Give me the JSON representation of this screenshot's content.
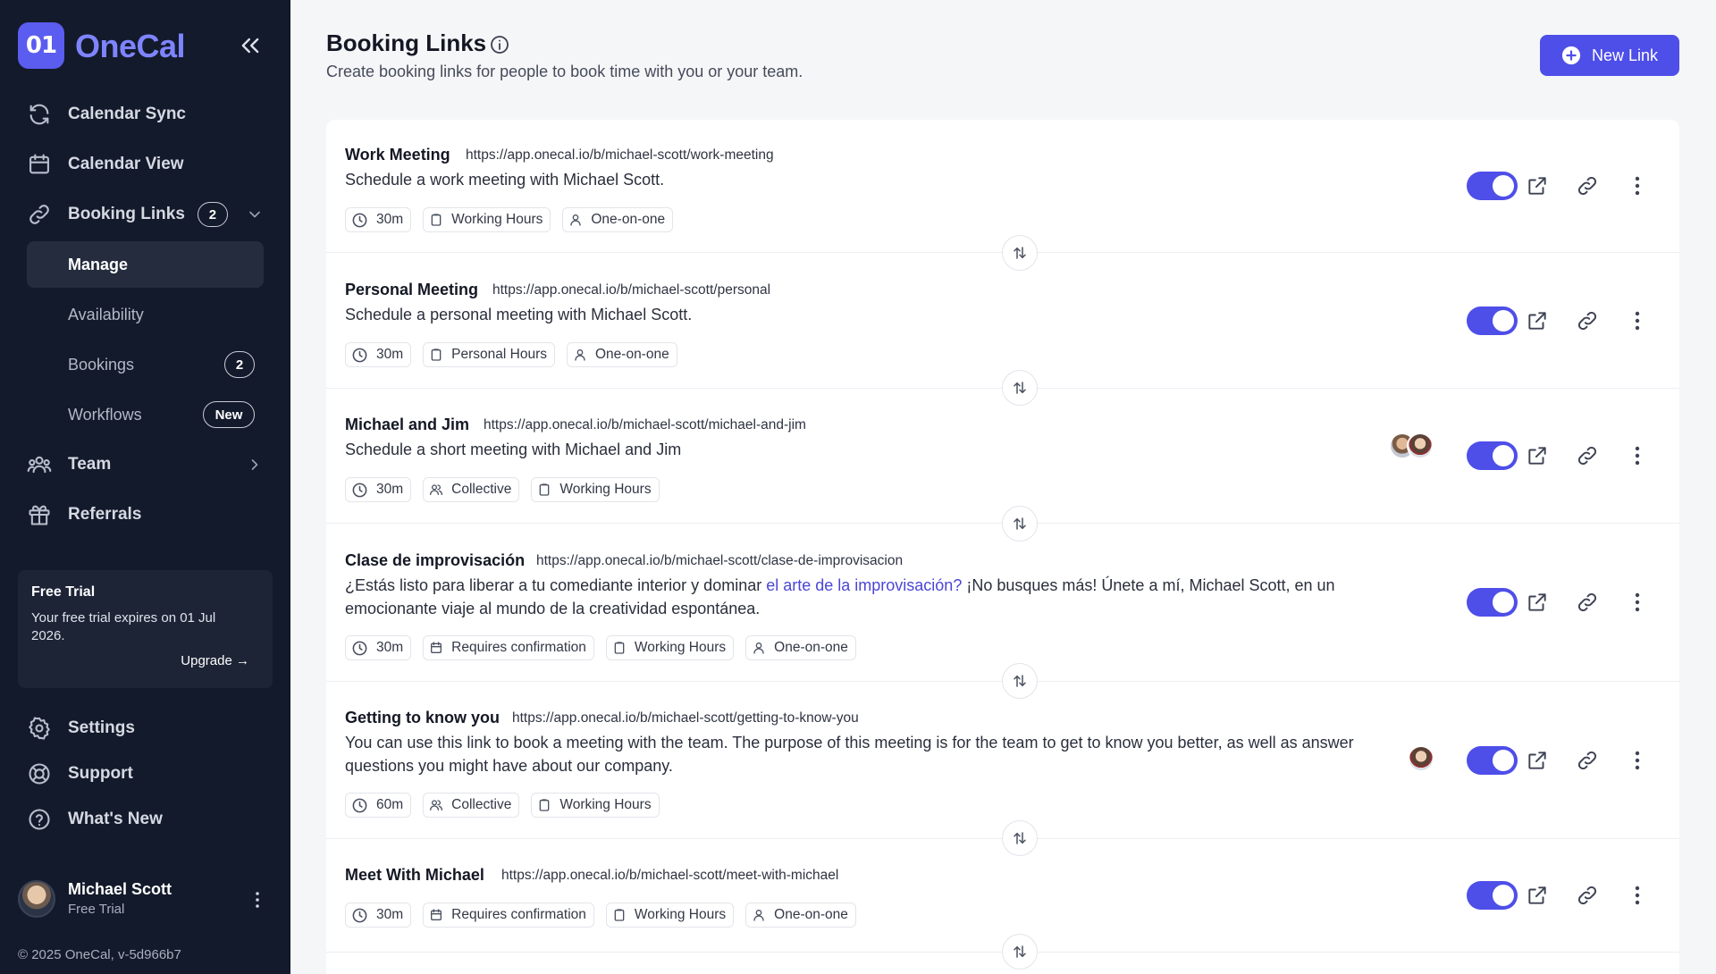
{
  "brand": {
    "logo_mark": "01",
    "name": "OneCal"
  },
  "sidebar": {
    "nav": {
      "calendar_sync": "Calendar Sync",
      "calendar_view": "Calendar View",
      "booking_links": "Booking Links",
      "booking_links_badge": "2",
      "team": "Team",
      "referrals": "Referrals",
      "settings": "Settings",
      "support": "Support",
      "whats_new": "What's New"
    },
    "sub": {
      "manage": "Manage",
      "availability": "Availability",
      "bookings": "Bookings",
      "bookings_badge": "2",
      "workflows": "Workflows",
      "workflows_badge": "New"
    },
    "trial": {
      "title": "Free Trial",
      "text": "Your free trial expires on 01 Jul 2026.",
      "upgrade": "Upgrade →"
    },
    "user": {
      "name": "Michael Scott",
      "plan": "Free Trial"
    },
    "copyright": "© 2025 OneCal, v-5d966b7"
  },
  "header": {
    "title": "Booking Links",
    "subtitle": "Create booking links for people to book time with you or your team.",
    "new_link": "New Link"
  },
  "links": [
    {
      "name": "Work Meeting",
      "url": "https://app.onecal.io/b/michael-scott/work-meeting",
      "description": "Schedule a work meeting with Michael Scott.",
      "tags": [
        "30m",
        "Working Hours",
        "One-on-one"
      ],
      "enabled": true
    },
    {
      "name": "Personal Meeting",
      "url": "https://app.onecal.io/b/michael-scott/personal",
      "description": "Schedule a personal meeting with Michael Scott.",
      "tags": [
        "30m",
        "Personal Hours",
        "One-on-one"
      ],
      "enabled": true
    },
    {
      "name": "Michael and Jim",
      "url": "https://app.onecal.io/b/michael-scott/michael-and-jim",
      "description": "Schedule a short meeting with Michael and Jim",
      "tags": [
        "30m",
        "Collective",
        "Working Hours"
      ],
      "enabled": true
    },
    {
      "name": "Clase de improvisación",
      "url": "https://app.onecal.io/b/michael-scott/clase-de-improvisacion",
      "description_pre": "¿Estás listo para liberar a tu comediante interior y dominar ",
      "description_link": "el arte de la improvisación?",
      "description_post": " ¡No busques más! Únete a mí, Michael Scott, en un emocionante viaje al mundo de la creatividad espontánea.",
      "tags": [
        "30m",
        "Requires confirmation",
        "Working Hours",
        "One-on-one"
      ],
      "enabled": true
    },
    {
      "name": "Getting to know you",
      "url": "https://app.onecal.io/b/michael-scott/getting-to-know-you",
      "description": "You can use this link to book a meeting with the team. The purpose of this meeting is for the team to get to know you better, as well as answer questions you might have about our company.",
      "tags": [
        "60m",
        "Collective",
        "Working Hours"
      ],
      "enabled": true
    },
    {
      "name": "Meet With Michael",
      "url": "https://app.onecal.io/b/michael-scott/meet-with-michael",
      "tags": [
        "30m",
        "Requires confirmation",
        "Working Hours",
        "One-on-one"
      ],
      "enabled": true
    }
  ],
  "colors": {
    "sidebar_bg": "#131a2b",
    "accent": "#4e4ee9",
    "logo_text": "#7e84ff",
    "page_bg": "#f5f6f8"
  }
}
